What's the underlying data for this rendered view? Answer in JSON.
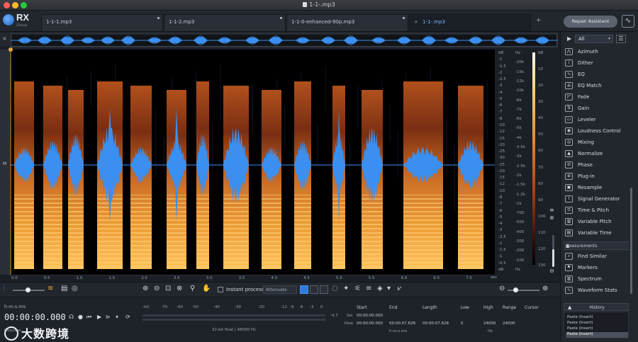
{
  "window": {
    "title": "1-1-.mp3"
  },
  "colors": {
    "accent": "#2e7be0",
    "close": "#ff5f57",
    "minimize": "#febc2e",
    "maximize": "#28c840",
    "waveform": "#3b8ff0",
    "playhead": "#e6a53a"
  },
  "logo": {
    "name": "RX",
    "sub": "iZotope"
  },
  "tabs": [
    {
      "label": "1-1-1.mp3",
      "active": false
    },
    {
      "label": "1-1-2.mp3",
      "active": false
    },
    {
      "label": "1-1-0-enhanced-90p.mp3",
      "active": false
    },
    {
      "label": "1-1-.mp3",
      "active": true
    }
  ],
  "repair_assistant": "Repair Assistant",
  "channel_label": "M",
  "db_scale": [
    "dB",
    "-1",
    "-1.5",
    "-2",
    "-2.5",
    "-3",
    "-4",
    "-5",
    "-6",
    "-7",
    "-8",
    "-10",
    "-12",
    "-15",
    "-20",
    "-25",
    "-30",
    "-25",
    "-20",
    "-15",
    "-12",
    "-10",
    "-8",
    "-7",
    "-6",
    "-5",
    "-4",
    "-3",
    "-2.5",
    "-2",
    "-1.5",
    "-1",
    "-0.5",
    "dB"
  ],
  "hz_scale": [
    "Hz",
    "-20k",
    "-15k",
    "-12k",
    "-10k",
    "-8k",
    "-7k",
    "-6k",
    "-5k",
    "-4k",
    "-3.5k",
    "-3k",
    "-2.5k",
    "-2k",
    "-1.5k",
    "-1.2k",
    "-1k",
    "-700",
    "-500",
    "-400",
    "-300",
    "-200",
    "-100",
    "Hz"
  ],
  "colorbar_scale": [
    "dB",
    "10",
    "20",
    "30",
    "40",
    "50",
    "60",
    "70",
    "80",
    "90",
    "100",
    "110",
    "120",
    "130"
  ],
  "timeline": [
    "0.0",
    "0.5",
    "1.0",
    "1.5",
    "2.0",
    "2.5",
    "3.0",
    "3.5",
    "4.0",
    "4.5",
    "5.0",
    "5.5",
    "6.0",
    "6.5",
    "7.0"
  ],
  "timeline_unit": "sec",
  "toolbar": {
    "instant_process": "Instant process",
    "attenuate": "Attenuate"
  },
  "transport": {
    "time_format": "h:m:s.ms",
    "timecode": "00:00:00.000"
  },
  "meter": {
    "scale": [
      "-Inf.",
      "-70",
      "-60",
      "-50",
      "-40",
      "-30",
      "-20",
      "-12",
      "-9",
      "-6",
      "-3",
      "0"
    ],
    "bit_depth": "32-bit float | 48000 Hz",
    "peak": "-4.7"
  },
  "selection_info": {
    "headers": [
      "Start",
      "End",
      "Length",
      "Low",
      "High",
      "Range",
      "Cursor"
    ],
    "sel_label": "Sel",
    "view_label": "View",
    "sel": {
      "start": "00:00:00.000"
    },
    "view": {
      "start": "00:00:00.000",
      "end": "00:00:07.628",
      "length": "00:00:07.628",
      "low": "0",
      "high": "24000",
      "range": "24000"
    },
    "time_unit": "h:m:s.ms",
    "freq_unit": "Hz"
  },
  "watermark": {
    "text": "大数跨境",
    "small": "Bsuccess..."
  },
  "panel": {
    "filter": "All",
    "modules": [
      "Azimuth",
      "Dither",
      "EQ",
      "EQ Match",
      "Fade",
      "Gain",
      "Leveler",
      "Loudness Control",
      "Mixing",
      "Normalize",
      "Phase",
      "Plug-in",
      "Resample",
      "Signal Generator",
      "Time & Pitch",
      "Variable Pitch",
      "Variable Time"
    ],
    "measurements_label": "Measurements",
    "measurements": [
      "Find Similar",
      "Markers",
      "Spectrum",
      "Waveform Stats"
    ]
  },
  "history": {
    "title": "History",
    "items": [
      "Paste (Insert)",
      "Paste (Insert)",
      "Paste (Insert)",
      "Paste (Insert)"
    ]
  }
}
